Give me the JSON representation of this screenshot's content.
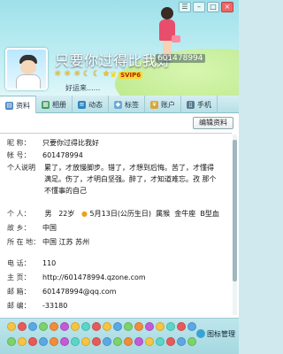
{
  "header": {
    "nickname": "只要你过得比我好",
    "qq_number": "601478994",
    "signature": "好运来......",
    "svip_label": "SVIP6",
    "level_icons": [
      "sun-icon",
      "sun-icon",
      "sun-icon",
      "moon-icon",
      "moon-icon",
      "star-icon"
    ],
    "window_controls": {
      "skin": "☰",
      "minimize": "–",
      "maximize": "□",
      "close": "×"
    }
  },
  "tabs": [
    {
      "label": "资料",
      "icon": "person-card-icon",
      "active": true
    },
    {
      "label": "相册",
      "icon": "photo-album-icon",
      "active": false
    },
    {
      "label": "动态",
      "icon": "feed-icon",
      "active": false
    },
    {
      "label": "标签",
      "icon": "tag-icon",
      "active": false
    },
    {
      "label": "账户",
      "icon": "account-icon",
      "active": false
    },
    {
      "label": "手机",
      "icon": "phone-icon",
      "active": false
    }
  ],
  "content": {
    "edit_button": "编辑资料",
    "fields": {
      "nickname": {
        "label": "昵    称：",
        "value": "只要你过得比我好"
      },
      "account": {
        "label": "帐    号：",
        "value": "601478994"
      },
      "desc_label": "个人说明",
      "desc_value": "累了，才放慢脚步。错了，才想到后悔。苦了，才懂得满足。伤了，才明白坚强。醉了，才知道难忘。孜  那个不懂事的自己",
      "personal": {
        "label": "个    人：",
        "gender": "男",
        "age": "22岁",
        "birthday": "5月13日(公历生日)",
        "zodiac": "属猴",
        "sign": "金牛座",
        "blood": "B型血"
      },
      "hometown": {
        "label": "故    乡：",
        "value": "中国"
      },
      "location": {
        "label": "所 在 地：",
        "value": "中国 江苏 苏州"
      },
      "phone": {
        "label": "电    话：",
        "value": "110"
      },
      "homepage": {
        "label": "主    页：",
        "value": "http://601478994.qzone.com"
      },
      "email": {
        "label": "邮    箱：",
        "value": "601478994@qq.com"
      },
      "zip": {
        "label": "邮    编：",
        "value": "-33180"
      }
    }
  },
  "footer": {
    "manage_label": "图标管理"
  },
  "colors": {
    "accent": "#3aa3d6",
    "tab_bar": "#b7dfe6",
    "header_sky": "#9fe0ea"
  }
}
